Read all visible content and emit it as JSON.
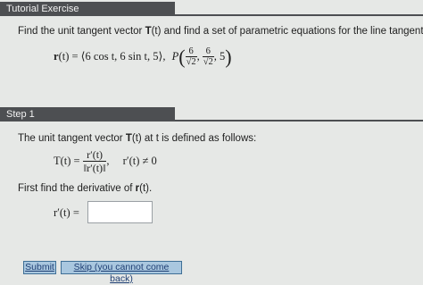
{
  "header": {
    "title": "Tutorial Exercise"
  },
  "problem": {
    "text_bold_t": "T",
    "text_a": "Find the unit tangent vector ",
    "text_b": "(t) and find a set of parametric equations for the line tangent",
    "r_lhs": "r",
    "r_arg": "(t) = ⟨6 cos t, 6 sin t, 5⟩,",
    "point_label": "P",
    "p_num1": "6",
    "p_den1": "√2",
    "p_num2": "6",
    "p_den2": "√2",
    "p_last": "5"
  },
  "step": {
    "label": "Step 1",
    "intro_a": "The unit tangent vector ",
    "intro_T": "T",
    "intro_b": "(t) at t is defined as follows:",
    "T_lhs": "T(t) =",
    "frac_num": "r′(t)",
    "frac_den": "‖r′(t)‖",
    "condition": "r′(t) ≠ 0",
    "derivative_a": "First find the derivative of ",
    "derivative_r": "r",
    "derivative_b": "(t).",
    "answer_label": "r′(t) =",
    "answer_value": ""
  },
  "buttons": {
    "submit": "Submit",
    "skip": "Skip (you cannot come back)"
  }
}
